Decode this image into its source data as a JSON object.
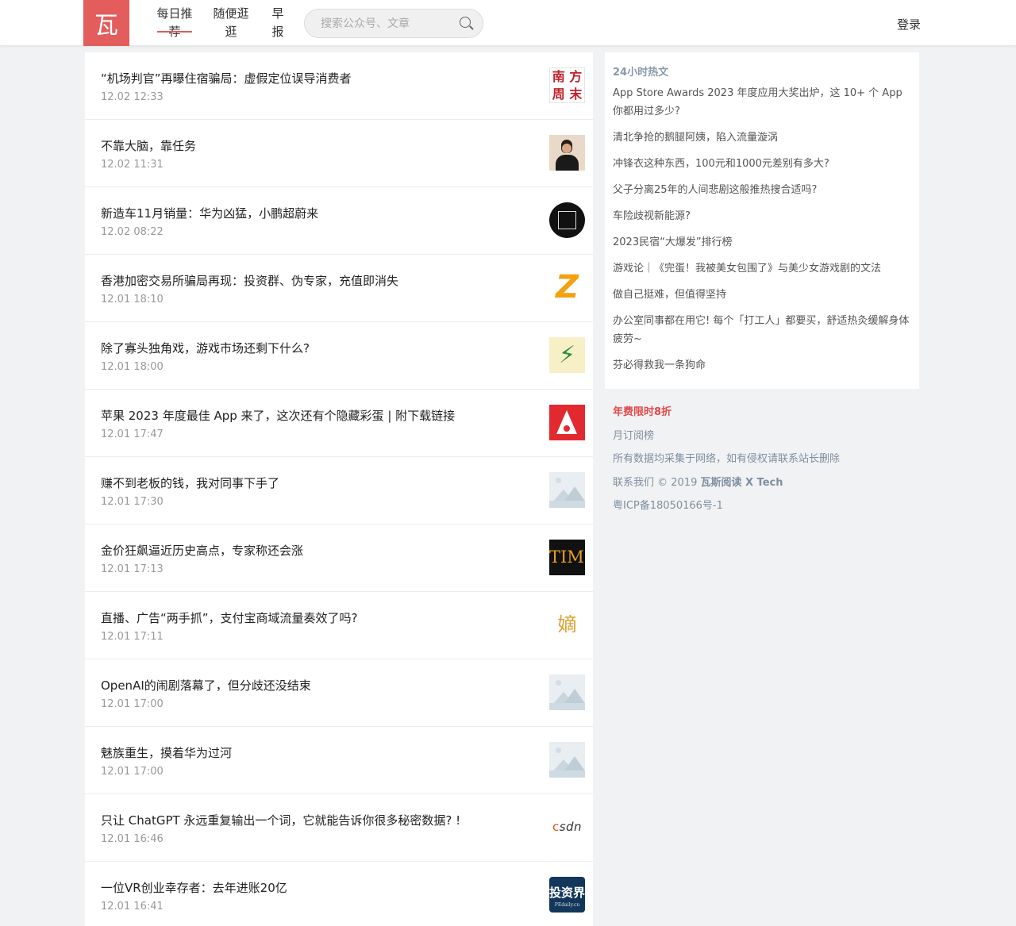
{
  "header": {
    "logo_char": "瓦",
    "nav": [
      "每日推荐",
      "随便逛逛",
      "早报"
    ],
    "search_placeholder": "搜索公众号、文章",
    "login": "登录"
  },
  "feed": [
    {
      "title": "“机场判官”再曝住宿骗局：虚假定位误导消费者",
      "time": "12.02 12:33",
      "thumb": "nanfang-logo"
    },
    {
      "title": "不靠大脑，靠任务",
      "time": "12.02 11:31",
      "thumb": "person-photo"
    },
    {
      "title": "新造车11月销量：华为凶猛，小鹏超蔚来",
      "time": "12.02 08:22",
      "thumb": "circle-logo"
    },
    {
      "title": "香港加密交易所骗局再现：投资群、伪专家，充值即消失",
      "time": "12.01 18:10",
      "thumb": "z-logo"
    },
    {
      "title": "除了寡头独角戏，游戏市场还剩下什么?",
      "time": "12.01 18:00",
      "thumb": "bolt-logo"
    },
    {
      "title": "苹果 2023 年度最佳 App 来了，这次还有个隐藏彩蛋 | 附下载链接",
      "time": "12.01 17:47",
      "thumb": "a-logo"
    },
    {
      "title": "赚不到老板的钱，我对同事下手了",
      "time": "12.01 17:30",
      "thumb": "placeholder-image"
    },
    {
      "title": "金价狂飙逼近历史高点，专家称还会涨",
      "time": "12.01 17:13",
      "thumb": "time-logo"
    },
    {
      "title": "直播、广告“两手抓”，支付宝商域流量奏效了吗?",
      "time": "12.01 17:11",
      "thumb": "zhi-logo"
    },
    {
      "title": "OpenAI的闹剧落幕了，但分歧还没结束",
      "time": "12.01 17:00",
      "thumb": "placeholder-image"
    },
    {
      "title": "魅族重生，摸着华为过河",
      "time": "12.01 17:00",
      "thumb": "placeholder-image"
    },
    {
      "title": "只让 ChatGPT 永远重复输出一个词，它就能告诉你很多秘密数据? !",
      "time": "12.01 16:46",
      "thumb": "csdn-logo"
    },
    {
      "title": "一位VR创业幸存者：去年进账20亿",
      "time": "12.01 16:41",
      "thumb": "tzj-logo"
    }
  ],
  "thumbs": {
    "nanfang": [
      "南",
      "方",
      "周",
      "末"
    ],
    "z": "Z",
    "bolt": "⚡",
    "time": "TIME",
    "zhi": "嫡",
    "csdn_c": "c",
    "csdn_rest": "sdn",
    "tzj": "投资界",
    "tzj_sub": "PEdaily.cn"
  },
  "hot": {
    "title": "24小时热文",
    "items": [
      "App Store Awards 2023 年度应用大奖出炉，这 10+ 个 App 你都用过多少?",
      "清北争抢的鹅腿阿姨，陷入流量漩涡",
      "冲锋衣这种东西，100元和1000元差别有多大?",
      "父子分离25年的人间悲剧这般推热搜合适吗?",
      "车险歧视新能源?",
      "2023民宿“大爆发”排行榜",
      "游戏论｜《完蛋！我被美女包围了》与美少女游戏剧的文法",
      "做自己挺难，但值得坚持",
      "办公室同事都在用它! 每个「打工人」都要买，舒适热灸缓解身体疲劳~",
      "芬必得救我一条狗命"
    ]
  },
  "footer": {
    "promo": "年费限时8折",
    "monthly": "月订阅榜",
    "disclaimer": "所有数据均采集于网络，如有侵权请联系站长删除",
    "contact_prefix": "联系我们 © 2019 ",
    "contact_brand": "瓦斯阅读 X Tech",
    "icp": "粤ICP备18050166号-1"
  },
  "colors": {
    "brand": "#e35d5d",
    "page_bg": "#f1f2f4",
    "muted": "#999999"
  }
}
